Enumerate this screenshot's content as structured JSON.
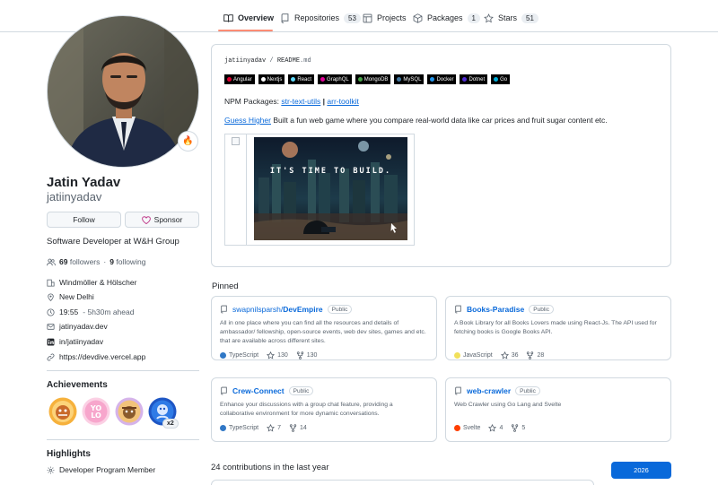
{
  "tabs": [
    {
      "label": "Overview",
      "icon": "book-icon"
    },
    {
      "label": "Repositories",
      "count": "53",
      "icon": "repo-icon"
    },
    {
      "label": "Projects",
      "icon": "table-icon"
    },
    {
      "label": "Packages",
      "count": "1",
      "icon": "package-icon"
    },
    {
      "label": "Stars",
      "count": "51",
      "icon": "star-icon"
    }
  ],
  "profile": {
    "name": "Jatin Yadav",
    "login": "jatiinyadav",
    "status_emoji": "🔥",
    "follow_label": "Follow",
    "sponsor_label": "Sponsor",
    "bio": "Software Developer at W&H Group",
    "followers_count": "69",
    "followers_label": "followers",
    "following_count": "9",
    "following_label": "following",
    "dot": "·",
    "details": [
      {
        "icon": "organization-icon",
        "text": "Windmöller & Hölscher"
      },
      {
        "icon": "location-icon",
        "text": "New Delhi"
      },
      {
        "icon": "clock-icon",
        "text": "19:55",
        "muted": "- 5h30m ahead"
      },
      {
        "icon": "mail-icon",
        "text": "jatinyadav.dev"
      },
      {
        "icon": "linkedin-icon",
        "text": "in/jatiinyadav"
      },
      {
        "icon": "link-icon",
        "text": "https://devdive.vercel.app"
      }
    ]
  },
  "achievements": {
    "title": "Achievements",
    "badges": [
      "pull-shark",
      "yolo",
      "quickdraw",
      "pair-extraordinaire"
    ],
    "multiplier": "x2"
  },
  "highlights": {
    "title": "Highlights",
    "items": [
      "Developer Program Member"
    ]
  },
  "readme": {
    "owner": "jatiinyadav",
    "slash": "/",
    "file": "README",
    "ext": ".md",
    "tech": [
      {
        "label": "Angular",
        "color": "#dd0031"
      },
      {
        "label": "Nextjs",
        "color": "#ffffff"
      },
      {
        "label": "React",
        "color": "#61dafb"
      },
      {
        "label": "GraphQL",
        "color": "#e10098"
      },
      {
        "label": "MongoDB",
        "color": "#47a248"
      },
      {
        "label": "MySQL",
        "color": "#4479a1"
      },
      {
        "label": "Docker",
        "color": "#2496ed"
      },
      {
        "label": "Dotnet",
        "color": "#512bd4"
      },
      {
        "label": "Go",
        "color": "#00add8"
      }
    ],
    "npm_label": "NPM Packages:",
    "npm_pkg1": "str-text-utils",
    "npm_sep": "|",
    "npm_pkg2": "arr-toolkit",
    "guess_link": "Guess Higher",
    "guess_text": "Built a fun web game where you compare real-world data like car prices and fruit sugar content etc.",
    "banner_text": "IT'S TIME TO BUILD."
  },
  "pinned": {
    "title": "Pinned",
    "cards": [
      {
        "owner": "swapnilsparsh/",
        "name": "DevEmpire",
        "visibility": "Public",
        "desc": "All in one place where you can find all the resources and details of ambassador/ fellowship, open-source events, web dev sites, games and etc. that are available across different sites.",
        "language": "TypeScript",
        "lang_color": "#3178c6",
        "stars": "130",
        "forks": "130"
      },
      {
        "owner": "",
        "name": "Books-Paradise",
        "visibility": "Public",
        "desc": "A Book Library for all Books Lovers made using React-Js. The API used for fetching books is Google Books API.",
        "language": "JavaScript",
        "lang_color": "#f1e05a",
        "stars": "36",
        "forks": "28"
      },
      {
        "owner": "",
        "name": "Crew-Connect",
        "visibility": "Public",
        "desc": "Enhance your discussions with a group chat feature, providing a collaborative environment for more dynamic conversations.",
        "language": "TypeScript",
        "lang_color": "#3178c6",
        "stars": "7",
        "forks": "14"
      },
      {
        "owner": "",
        "name": "web-crawler",
        "visibility": "Public",
        "desc": "Web Crawler using Go Lang and Svelte",
        "language": "Svelte",
        "lang_color": "#ff3e00",
        "stars": "4",
        "forks": "5"
      }
    ]
  },
  "contributions": {
    "title": "24 contributions in the last year",
    "year": "2026"
  }
}
